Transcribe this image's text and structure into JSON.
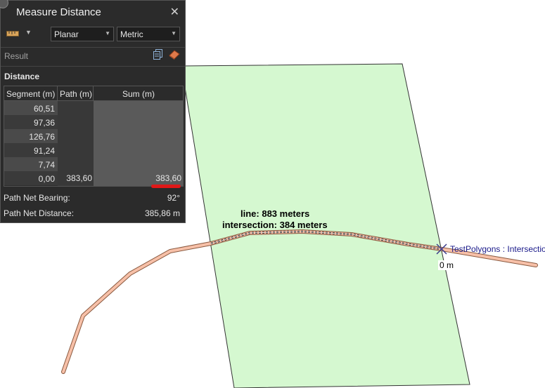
{
  "panel": {
    "title": "Measure Distance",
    "close_glyph": "✕",
    "mode_select": "Planar",
    "units_select": "Metric",
    "dropdown_glyph": "▼",
    "result_label": "Result",
    "distance_label": "Distance",
    "icons": [
      "ruler-icon",
      "copy-icon",
      "eraser-icon",
      "close-icon"
    ]
  },
  "table": {
    "headers": [
      "Segment (m)",
      "Path (m)",
      "Sum (m)"
    ],
    "segments": [
      "60,51",
      "97,36",
      "126,76",
      "91,24",
      "7,74",
      "0,00"
    ],
    "path_total": "383,60",
    "sum_total": "383,60"
  },
  "stats": {
    "bearing_label": "Path Net Bearing:",
    "bearing_value": "92°",
    "net_distance_label": "Path Net Distance:",
    "net_distance_value": "385,86 m"
  },
  "map": {
    "line_label": "line: 883 meters",
    "intersection_label": "intersection: 384 meters",
    "polygon_label": "TestPolygons : Intersectio",
    "zero_label": "0 m",
    "colors": {
      "polygon_fill": "#d5f8d0",
      "line": "#f3a98a",
      "highlight": "#ff2020"
    }
  }
}
